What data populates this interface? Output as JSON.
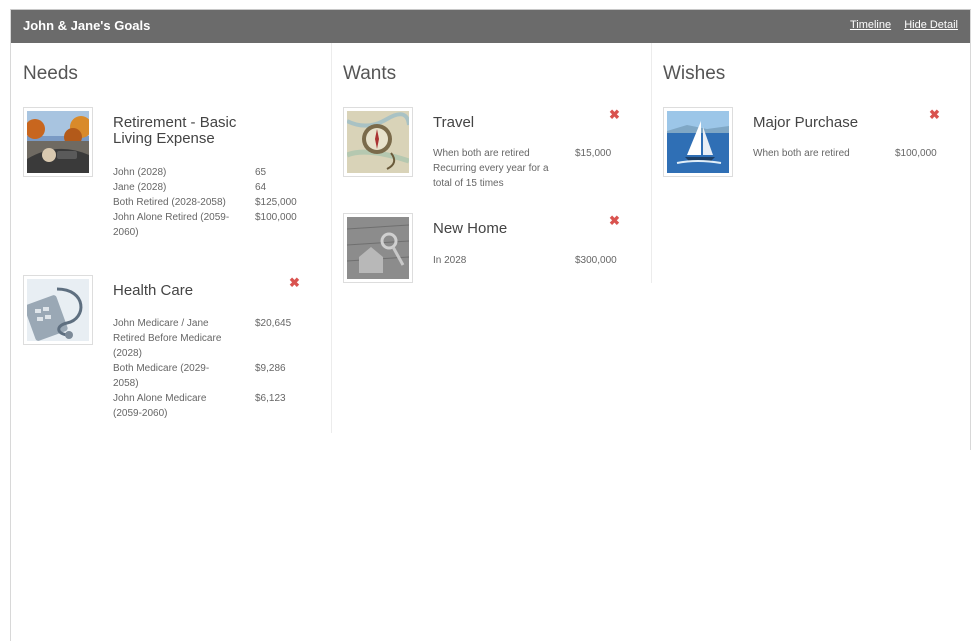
{
  "header": {
    "title": "John & Jane's Goals",
    "links": [
      "Timeline",
      "Hide Detail"
    ]
  },
  "columns": {
    "needs": {
      "heading": "Needs",
      "goals": [
        {
          "title": "Retirement - Basic Living Expense",
          "image": "car-driving-autumn",
          "rows": [
            {
              "label": "John (2028)",
              "value": "65"
            },
            {
              "label": "Jane (2028)",
              "value": "64"
            },
            {
              "label": "Both Retired (2028-2058)",
              "value": "$125,000"
            },
            {
              "label": "John Alone Retired (2059-2060)",
              "value": "$100,000"
            }
          ]
        },
        {
          "title": "Health Care",
          "image": "stethoscope-calculator",
          "remove_icon": "✖",
          "rows": [
            {
              "label": "John Medicare / Jane Retired Before Medicare (2028)",
              "value": "$20,645"
            },
            {
              "label": "Both Medicare (2029-2058)",
              "value": "$9,286"
            },
            {
              "label": "John Alone Medicare (2059-2060)",
              "value": "$6,123"
            }
          ]
        }
      ]
    },
    "wants": {
      "heading": "Wants",
      "goals": [
        {
          "title": "Travel",
          "image": "compass-map",
          "remove_icon": "✖",
          "rows": [
            {
              "label": "When both are retired Recurring every year for a total of 15 times",
              "value": "$15,000"
            }
          ]
        },
        {
          "title": "New Home",
          "image": "house-keys",
          "remove_icon": "✖",
          "rows": [
            {
              "label": "In 2028",
              "value": "$300,000"
            }
          ]
        }
      ]
    },
    "wishes": {
      "heading": "Wishes",
      "goals": [
        {
          "title": "Major Purchase",
          "image": "sailboat",
          "remove_icon": "✖",
          "rows": [
            {
              "label": "When both are retired",
              "value": "$100,000"
            }
          ]
        }
      ]
    }
  },
  "colors": {
    "header_bg": "#6b6b6b",
    "remove": "#d9534f"
  }
}
